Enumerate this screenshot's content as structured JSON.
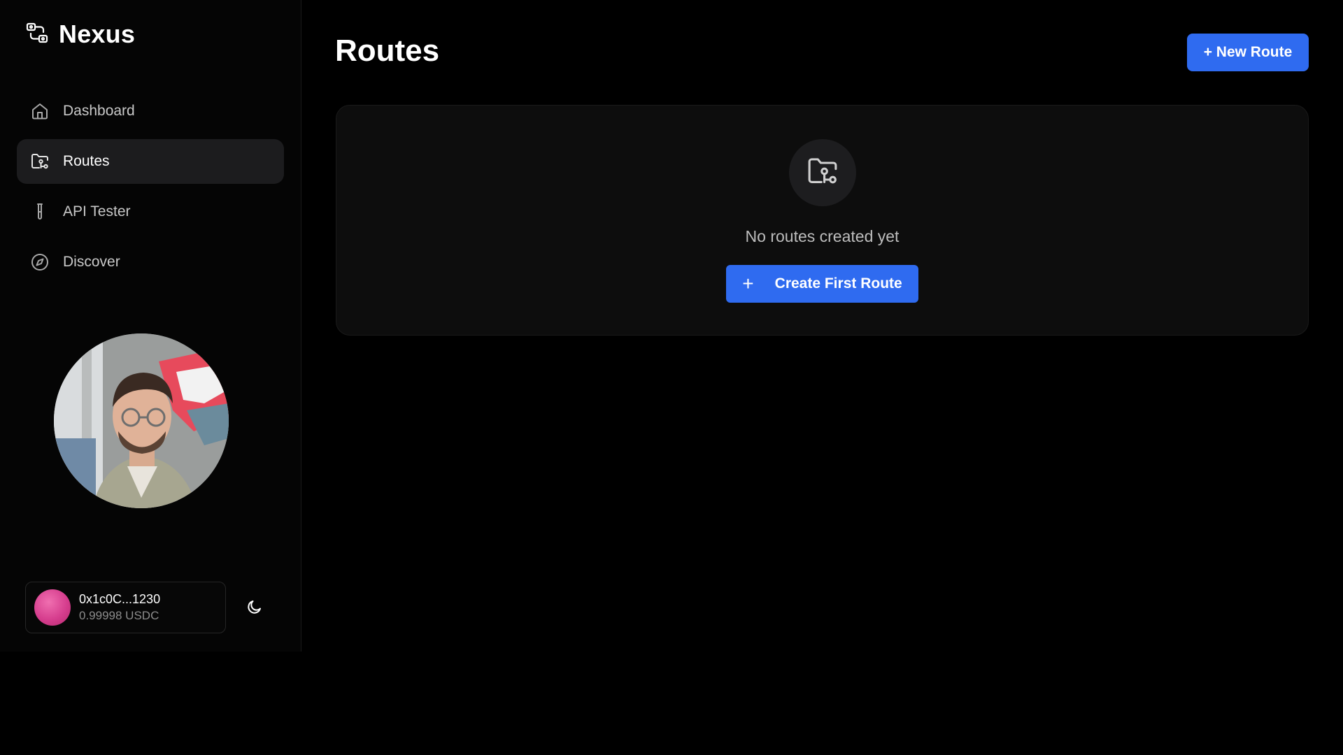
{
  "sidebar": {
    "brand": {
      "name": "Nexus",
      "icon": "route-logo-icon"
    },
    "nav": [
      {
        "label": "Dashboard",
        "icon": "home-icon",
        "active": false
      },
      {
        "label": "Routes",
        "icon": "folder-route-icon",
        "active": true
      },
      {
        "label": "API Tester",
        "icon": "test-tube-icon",
        "active": false
      },
      {
        "label": "Discover",
        "icon": "compass-icon",
        "active": false
      }
    ],
    "wallet": {
      "address": "0x1c0C...1230",
      "balance": "0.99998 USDC",
      "avatar_color": "#d63e8e"
    },
    "theme_toggle_icon": "moon-icon"
  },
  "main": {
    "title": "Routes",
    "new_route_label": "+ New Route",
    "empty_state": {
      "icon": "folder-route-icon",
      "message": "No routes created yet",
      "button_label": "Create First Route",
      "button_icon": "plus-icon"
    }
  },
  "colors": {
    "accent": "#2f6bf0",
    "background": "#000000",
    "card": "#0d0d0d",
    "active_nav": "#1c1c1e"
  }
}
